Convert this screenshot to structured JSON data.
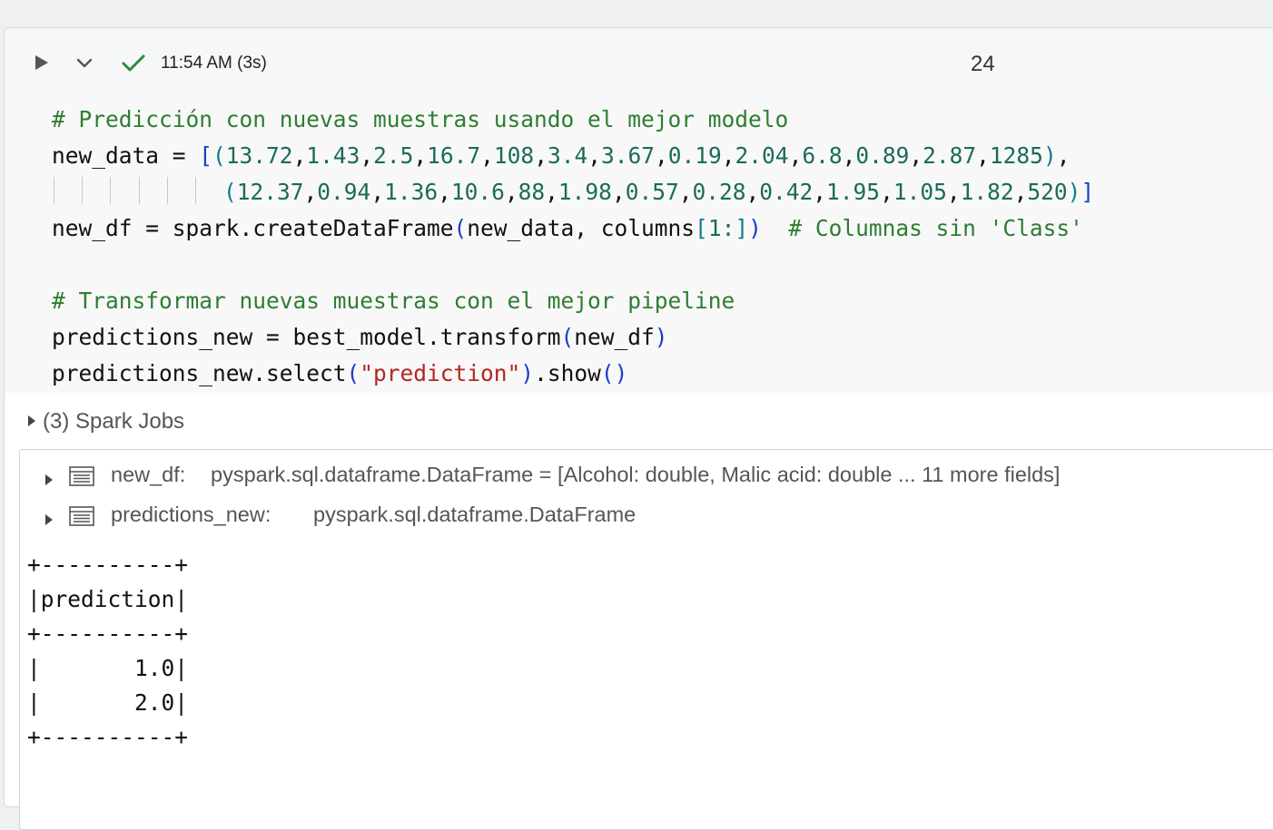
{
  "toolbar": {
    "run_time": "11:54 AM (3s)",
    "cell_number": "24"
  },
  "code": {
    "line1_comment": "# Predicción con nuevas muestras usando el mejor modelo",
    "line2_var": "new_data = ",
    "row1": [
      "13.72",
      "1.43",
      "2.5",
      "16.7",
      "108",
      "3.4",
      "3.67",
      "0.19",
      "2.04",
      "6.8",
      "0.89",
      "2.87",
      "1285"
    ],
    "row2": [
      "12.37",
      "0.94",
      "1.36",
      "10.6",
      "88",
      "1.98",
      "0.57",
      "0.28",
      "0.42",
      "1.95",
      "1.05",
      "1.82",
      "520"
    ],
    "line4_a": "new_df = spark.createDataFrame",
    "line4_b": "new_data, columns",
    "line4_slice": "1:",
    "line4_comment": "# Columnas sin 'Class'",
    "line6_comment": "# Transformar nuevas muestras con el mejor pipeline",
    "line7_a": "predictions_new = best_model.transform",
    "line7_arg": "new_df",
    "line8_a": "predictions_new.select",
    "line8_str": "\"prediction\"",
    "line8_b": ".show"
  },
  "spark_jobs_label": "(3) Spark Jobs",
  "dataframes": [
    {
      "name": "new_df:",
      "type": "pyspark.sql.dataframe.DataFrame = [Alcohol: double, Malic acid: double ... 11 more fields]"
    },
    {
      "name": "predictions_new:",
      "type": "pyspark.sql.dataframe.DataFrame"
    }
  ],
  "table_output": "+----------+\n|prediction|\n+----------+\n|       1.0|\n|       2.0|\n+----------+"
}
